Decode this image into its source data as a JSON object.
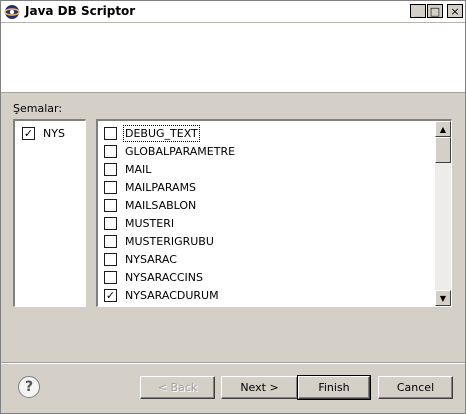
{
  "window": {
    "title": "Java DB Scriptor",
    "controls": {
      "minimize": "_",
      "maximize": "□",
      "close": "×"
    }
  },
  "schemas": {
    "label": "Şemalar:",
    "items": [
      {
        "name": "NYS",
        "checked": true
      }
    ]
  },
  "tables": [
    {
      "name": "DEBUG_TEXT",
      "checked": false
    },
    {
      "name": "GLOBALPARAMETRE",
      "checked": false
    },
    {
      "name": "MAIL",
      "checked": false
    },
    {
      "name": "MAILPARAMS",
      "checked": false
    },
    {
      "name": "MAILSABLON",
      "checked": false
    },
    {
      "name": "MUSTERI",
      "checked": false
    },
    {
      "name": "MUSTERIGRUBU",
      "checked": false
    },
    {
      "name": "NYSARAC",
      "checked": false
    },
    {
      "name": "NYSARACCINS",
      "checked": false
    },
    {
      "name": "NYSARACDURUM",
      "checked": true
    }
  ],
  "buttons": {
    "help": "?",
    "back": "< Back",
    "next": "Next >",
    "finish": "Finish",
    "cancel": "Cancel"
  },
  "icons": {
    "app": "java-app-icon",
    "help": "help-icon",
    "scroll_up": "scroll-up-arrow-icon",
    "scroll_down": "scroll-down-arrow-icon"
  }
}
